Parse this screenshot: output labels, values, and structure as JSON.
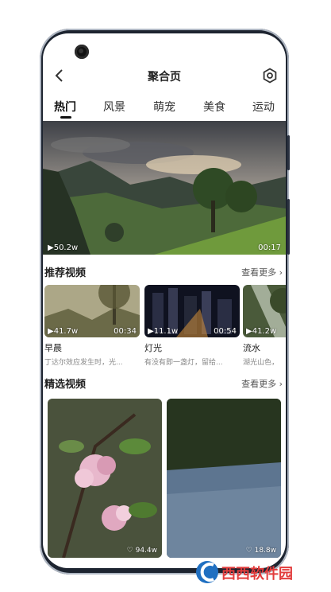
{
  "header": {
    "title": "聚合页"
  },
  "tabs": [
    {
      "label": "热门",
      "active": true
    },
    {
      "label": "风景",
      "active": false
    },
    {
      "label": "萌宠",
      "active": false
    },
    {
      "label": "美食",
      "active": false
    },
    {
      "label": "运动",
      "active": false
    }
  ],
  "hero": {
    "views": "50.2w",
    "duration": "00:17"
  },
  "recommended": {
    "title": "推荐视频",
    "more": "查看更多",
    "items": [
      {
        "title": "早晨",
        "desc": "丁达尔效应发生时，光...",
        "views": "41.7w",
        "duration": "00:34"
      },
      {
        "title": "灯光",
        "desc": "有没有即一盏灯，留给...",
        "views": "11.1w",
        "duration": "00:54"
      },
      {
        "title": "流水",
        "desc": "湖光山色，",
        "views": "41.2w",
        "duration": ""
      }
    ]
  },
  "featured": {
    "title": "精选视频",
    "more": "查看更多",
    "items": [
      {
        "likes": "94.4w"
      },
      {
        "likes": "18.8w"
      }
    ]
  },
  "watermark": {
    "text": "西西软件园"
  },
  "colors": {
    "accent": "#111111",
    "frame": "#1d2430"
  },
  "icons": [
    "back-arrow-icon",
    "gear-icon",
    "play-icon",
    "chevron-right-icon",
    "heart-icon"
  ]
}
